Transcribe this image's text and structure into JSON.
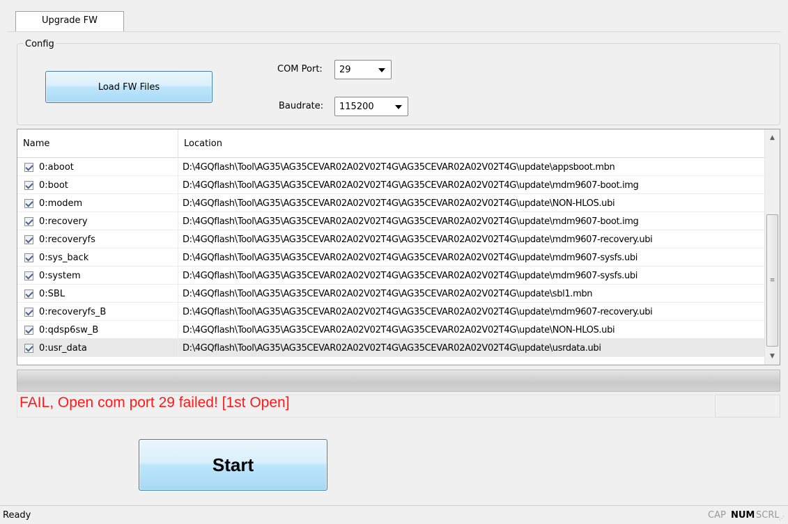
{
  "tab": {
    "label": "Upgrade FW"
  },
  "config": {
    "title": "Config",
    "load_button": "Load FW Files",
    "com_port_label": "COM Port:",
    "com_port_value": "29",
    "baudrate_label": "Baudrate:",
    "baudrate_value": "115200"
  },
  "table": {
    "columns": [
      "Name",
      "Location"
    ],
    "rows": [
      {
        "checked": true,
        "name": "0:aboot",
        "location": "D:\\4GQflash\\Tool\\AG35\\AG35CEVAR02A02V02T4G\\AG35CEVAR02A02V02T4G\\update\\appsboot.mbn"
      },
      {
        "checked": true,
        "name": "0:boot",
        "location": "D:\\4GQflash\\Tool\\AG35\\AG35CEVAR02A02V02T4G\\AG35CEVAR02A02V02T4G\\update\\mdm9607-boot.img"
      },
      {
        "checked": true,
        "name": "0:modem",
        "location": "D:\\4GQflash\\Tool\\AG35\\AG35CEVAR02A02V02T4G\\AG35CEVAR02A02V02T4G\\update\\NON-HLOS.ubi"
      },
      {
        "checked": true,
        "name": "0:recovery",
        "location": "D:\\4GQflash\\Tool\\AG35\\AG35CEVAR02A02V02T4G\\AG35CEVAR02A02V02T4G\\update\\mdm9607-boot.img"
      },
      {
        "checked": true,
        "name": "0:recoveryfs",
        "location": "D:\\4GQflash\\Tool\\AG35\\AG35CEVAR02A02V02T4G\\AG35CEVAR02A02V02T4G\\update\\mdm9607-recovery.ubi"
      },
      {
        "checked": true,
        "name": "0:sys_back",
        "location": "D:\\4GQflash\\Tool\\AG35\\AG35CEVAR02A02V02T4G\\AG35CEVAR02A02V02T4G\\update\\mdm9607-sysfs.ubi"
      },
      {
        "checked": true,
        "name": "0:system",
        "location": "D:\\4GQflash\\Tool\\AG35\\AG35CEVAR02A02V02T4G\\AG35CEVAR02A02V02T4G\\update\\mdm9607-sysfs.ubi"
      },
      {
        "checked": true,
        "name": "0:SBL",
        "location": "D:\\4GQflash\\Tool\\AG35\\AG35CEVAR02A02V02T4G\\AG35CEVAR02A02V02T4G\\update\\sbl1.mbn"
      },
      {
        "checked": true,
        "name": "0:recoveryfs_B",
        "location": "D:\\4GQflash\\Tool\\AG35\\AG35CEVAR02A02V02T4G\\AG35CEVAR02A02V02T4G\\update\\mdm9607-recovery.ubi"
      },
      {
        "checked": true,
        "name": "0:qdsp6sw_B",
        "location": "D:\\4GQflash\\Tool\\AG35\\AG35CEVAR02A02V02T4G\\AG35CEVAR02A02V02T4G\\update\\NON-HLOS.ubi"
      },
      {
        "checked": true,
        "name": "0:usr_data",
        "location": "D:\\4GQflash\\Tool\\AG35\\AG35CEVAR02A02V02T4G\\AG35CEVAR02A02V02T4G\\update\\usrdata.ubi"
      }
    ]
  },
  "progress": {
    "value": 0
  },
  "message": {
    "text": "FAIL, Open com port 29 failed! [1st Open]",
    "color": "#ff1a1a"
  },
  "start_button": "Start",
  "statusbar": {
    "ready": "Ready",
    "cap": "CAP",
    "num": "NUM",
    "scrl": "SCRL"
  },
  "icons": {
    "scroll_up": "scroll-up-arrow-icon",
    "scroll_down": "scroll-down-arrow-icon",
    "checkbox": "checkbox-checked-icon",
    "combo_arrow": "dropdown-arrow-icon"
  },
  "colors": {
    "button_border": "#3c7fb1",
    "button_fill": "#bee6fd",
    "error_text": "#ff1a1a",
    "background": "#f0f0f0"
  }
}
